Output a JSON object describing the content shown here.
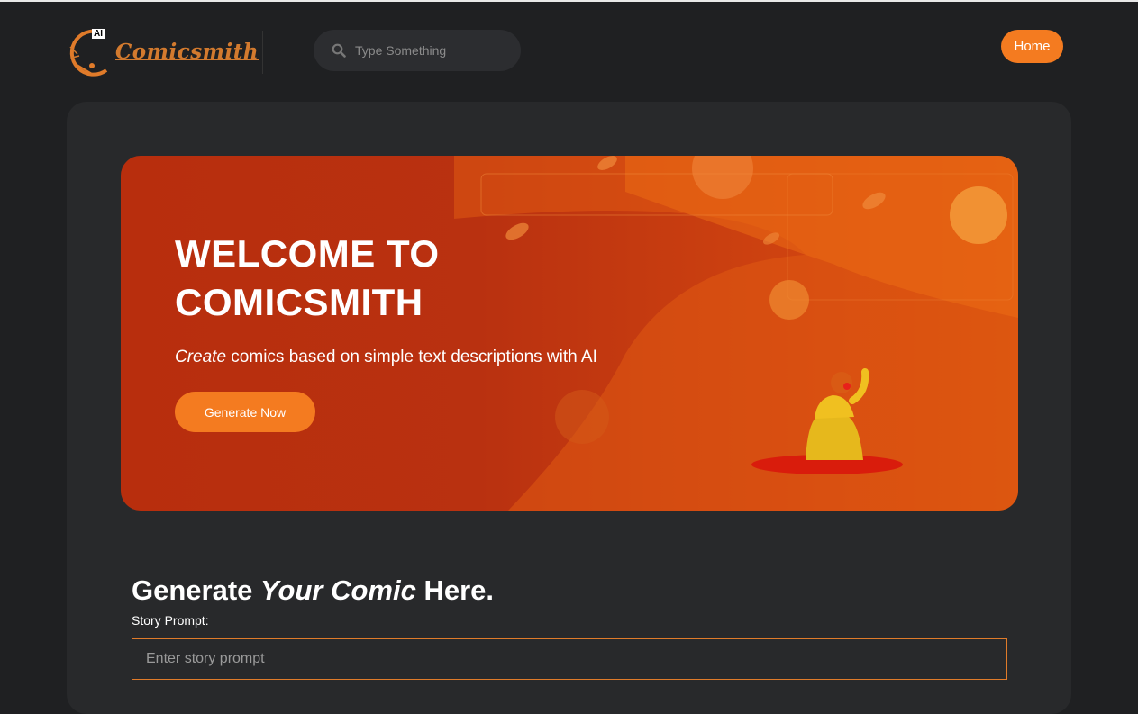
{
  "header": {
    "logo_text": "Comicsmith",
    "logo_badge": "AI",
    "search_placeholder": "Type Something",
    "home_label": "Home"
  },
  "hero": {
    "title_line1": "WELCOME TO",
    "title_line2": "COMICSMITH",
    "subtitle_em": "Create",
    "subtitle_rest": " comics based on simple text descriptions with AI",
    "button_label": "Generate Now"
  },
  "generator": {
    "heading_pre": "Generate ",
    "heading_em": "Your Comic",
    "heading_post": " Here.",
    "prompt_label": "Story Prompt:",
    "prompt_placeholder": "Enter story prompt"
  },
  "colors": {
    "accent": "#f47b20",
    "background": "#1f2022",
    "panel": "#28292b",
    "hero": "#b82e0d"
  },
  "icons": [
    "comicsmith-logo-icon",
    "search-icon"
  ]
}
